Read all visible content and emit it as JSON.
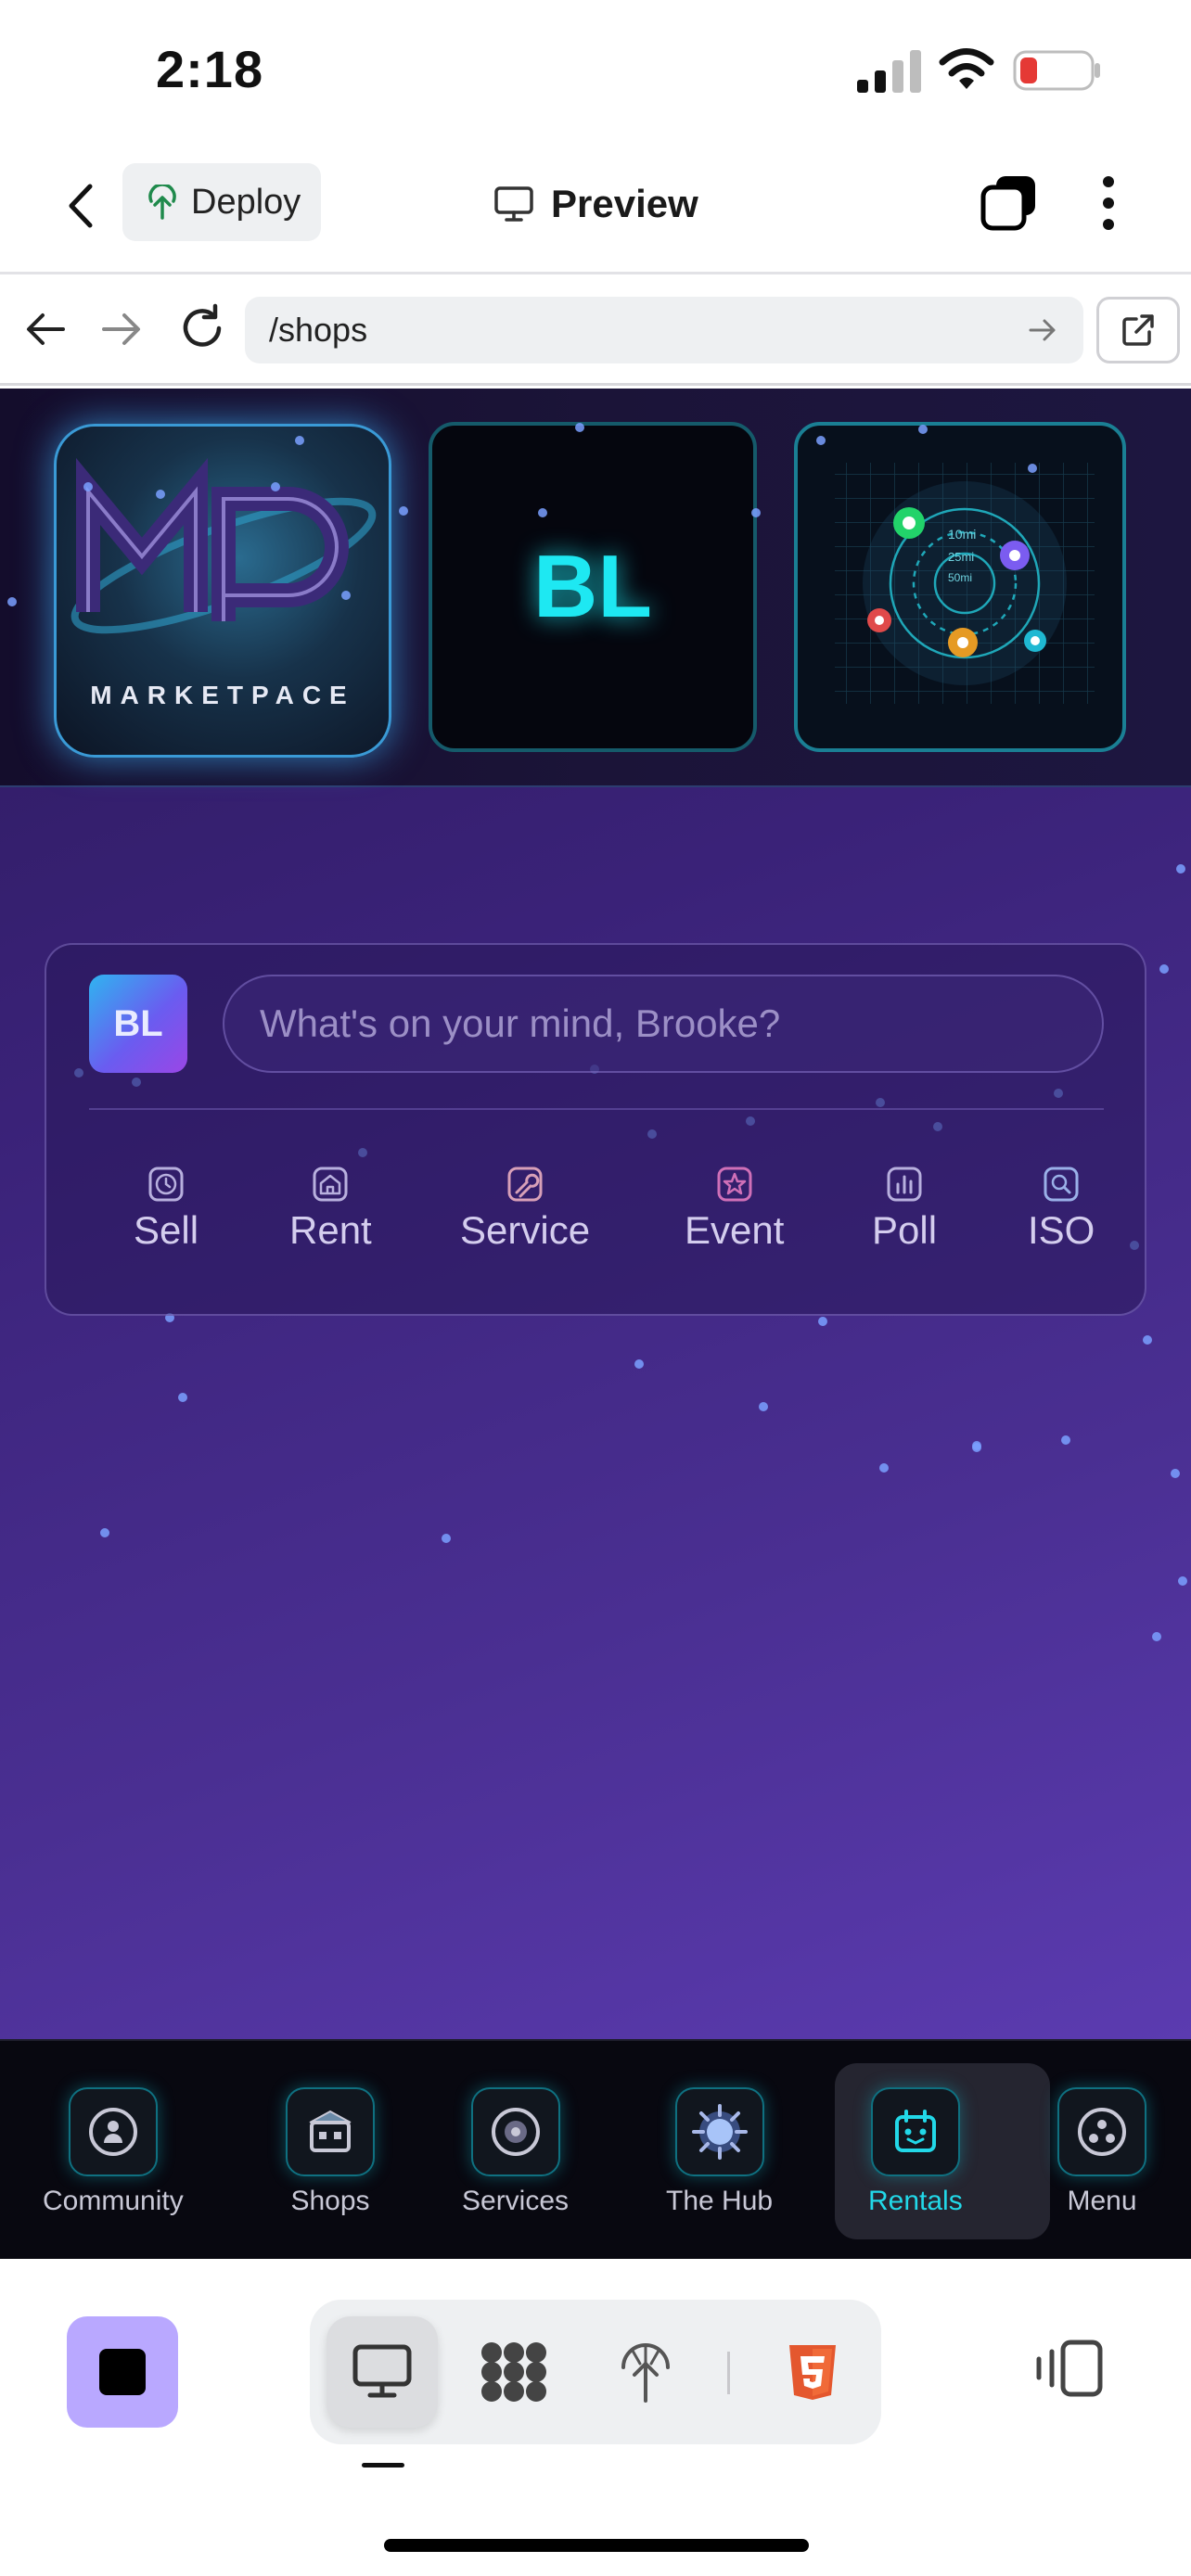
{
  "status_bar": {
    "time": "2:18"
  },
  "header": {
    "deploy_label": "Deploy",
    "title": "Preview"
  },
  "browser": {
    "url": "/shops"
  },
  "banner": {
    "logo_word": "MARKETPACE",
    "tile_initials": "BL"
  },
  "radar": {
    "ring_labels": [
      "10mi",
      "25mi",
      "50mi"
    ]
  },
  "composer": {
    "avatar_initials": "BL",
    "placeholder": "What's on your mind, Brooke?",
    "actions": [
      {
        "label": "Sell",
        "icon": "clock-icon"
      },
      {
        "label": "Rent",
        "icon": "house-icon"
      },
      {
        "label": "Service",
        "icon": "wrench-icon"
      },
      {
        "label": "Event",
        "icon": "star-icon"
      },
      {
        "label": "Poll",
        "icon": "bar-chart-icon"
      },
      {
        "label": "ISO",
        "icon": "search-icon"
      }
    ]
  },
  "bottom_nav": {
    "items": [
      {
        "label": "Community",
        "icon": "community-icon"
      },
      {
        "label": "Shops",
        "icon": "shop-icon"
      },
      {
        "label": "Services",
        "icon": "services-icon"
      },
      {
        "label": "The Hub",
        "icon": "hub-icon"
      },
      {
        "label": "Rentals",
        "icon": "calendar-icon"
      },
      {
        "label": "Menu",
        "icon": "menu-icon"
      }
    ],
    "active": "Rentals"
  },
  "colors": {
    "accent_cyan": "#22d8e8",
    "viewport_purple": "#4a2f92",
    "stop_button": "#b9a8ff",
    "html5_orange": "#e4572e"
  }
}
